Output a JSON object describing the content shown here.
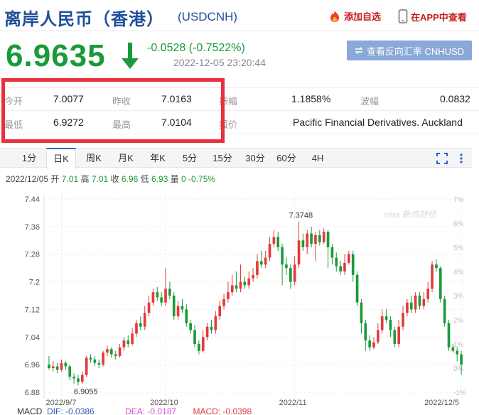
{
  "header": {
    "title": "离岸人民币（香港）",
    "code": "(USDCNH)",
    "add_fav_label": "添加自选",
    "app_view_label": "在APP中查看"
  },
  "quote": {
    "price": "6.9635",
    "change": "-0.0528 (-0.7522%)",
    "timestamp": "2022-12-05 23:20:44",
    "reverse_button_label": "查看反向汇率 CNHUSD"
  },
  "stats": {
    "open_label": "今开",
    "open_value": "7.0077",
    "prev_close_label": "昨收",
    "prev_close_value": "7.0163",
    "amplitude_label": "振幅",
    "amplitude_value": "1.1858%",
    "wave_label": "波幅",
    "wave_value": "0.0832",
    "low_label": "最低",
    "low_value": "6.9272",
    "high_label": "最高",
    "high_value": "7.0104",
    "quote_label": "报价",
    "quote_value": "Pacific Financial Derivatives. Auckland"
  },
  "tabs": [
    "1分",
    "日K",
    "周K",
    "月K",
    "年K",
    "5分",
    "15分",
    "30分",
    "60分",
    "4H"
  ],
  "active_tab": "日K",
  "ohlc": {
    "date": "2022/12/05",
    "open_label": "开",
    "open": "7.01",
    "high_label": "高",
    "high": "7.01",
    "close_label": "收",
    "close": "6.96",
    "low_label": "低",
    "low": "6.93",
    "vol_label": "量",
    "vol": "0",
    "pct": "-0.75%"
  },
  "chart_data": {
    "type": "candlestick",
    "y_ticks": [
      "7.44",
      "7.36",
      "7.28",
      "7.2",
      "7.12",
      "7.04",
      "6.96",
      "6.88"
    ],
    "pct_ticks": [
      "7%",
      "6%",
      "5%",
      "4%",
      "3%",
      "2%",
      "1%",
      "0%",
      "-1%"
    ],
    "x_ticks": [
      "2022/9/7",
      "2022/10",
      "2022/11",
      "2022/12/5"
    ],
    "ylim": [
      6.88,
      7.44
    ],
    "annotations": {
      "max": "7.3748",
      "min": "6.9055"
    },
    "up_color": "#e23b3b",
    "down_color": "#1a9a3b",
    "candles": [
      [
        6.96,
        6.95,
        6.985,
        6.945
      ],
      [
        6.95,
        6.955,
        6.97,
        6.94
      ],
      [
        6.955,
        6.945,
        6.965,
        6.935
      ],
      [
        6.945,
        6.965,
        6.975,
        6.94
      ],
      [
        6.965,
        6.955,
        6.97,
        6.945
      ],
      [
        6.955,
        6.925,
        6.96,
        6.915
      ],
      [
        6.925,
        6.92,
        6.935,
        6.905
      ],
      [
        6.92,
        6.91,
        6.93,
        6.9
      ],
      [
        6.91,
        6.93,
        6.94,
        6.905
      ],
      [
        6.93,
        6.98,
        6.985,
        6.925
      ],
      [
        6.98,
        6.975,
        6.99,
        6.965
      ],
      [
        6.975,
        6.965,
        6.985,
        6.955
      ],
      [
        6.965,
        6.96,
        6.975,
        6.95
      ],
      [
        6.96,
        6.995,
        7.0,
        6.955
      ],
      [
        6.995,
        7.005,
        7.015,
        6.985
      ],
      [
        7.005,
        6.99,
        7.01,
        6.98
      ],
      [
        6.99,
        6.985,
        7.0,
        6.975
      ],
      [
        6.985,
        7.01,
        7.02,
        6.98
      ],
      [
        7.01,
        7.03,
        7.04,
        7.0
      ],
      [
        7.03,
        7.02,
        7.045,
        7.01
      ],
      [
        7.02,
        7.05,
        7.065,
        7.015
      ],
      [
        7.05,
        7.08,
        7.09,
        7.04
      ],
      [
        7.08,
        7.07,
        7.1,
        7.06
      ],
      [
        7.07,
        7.11,
        7.13,
        7.06
      ],
      [
        7.11,
        7.14,
        7.16,
        7.1
      ],
      [
        7.14,
        7.17,
        7.18,
        7.13
      ],
      [
        7.17,
        7.155,
        7.185,
        7.145
      ],
      [
        7.155,
        7.14,
        7.17,
        7.13
      ],
      [
        7.14,
        7.18,
        7.24,
        7.13
      ],
      [
        7.18,
        7.16,
        7.2,
        7.15
      ],
      [
        7.16,
        7.1,
        7.17,
        7.09
      ],
      [
        7.1,
        7.13,
        7.145,
        7.09
      ],
      [
        7.13,
        7.12,
        7.15,
        7.11
      ],
      [
        7.12,
        7.08,
        7.135,
        7.07
      ],
      [
        7.08,
        7.06,
        7.09,
        7.05
      ],
      [
        7.06,
        7.02,
        7.075,
        7.01
      ],
      [
        7.02,
        7.0,
        7.03,
        6.99
      ],
      [
        7.0,
        7.04,
        7.06,
        6.995
      ],
      [
        7.04,
        7.07,
        7.08,
        7.03
      ],
      [
        7.07,
        7.06,
        7.09,
        7.05
      ],
      [
        7.06,
        7.1,
        7.115,
        7.05
      ],
      [
        7.1,
        7.13,
        7.145,
        7.09
      ],
      [
        7.13,
        7.15,
        7.165,
        7.12
      ],
      [
        7.15,
        7.17,
        7.2,
        7.14
      ],
      [
        7.17,
        7.19,
        7.22,
        7.16
      ],
      [
        7.19,
        7.18,
        7.23,
        7.17
      ],
      [
        7.18,
        7.2,
        7.25,
        7.17
      ],
      [
        7.2,
        7.19,
        7.215,
        7.18
      ],
      [
        7.19,
        7.21,
        7.23,
        7.18
      ],
      [
        7.21,
        7.22,
        7.24,
        7.2
      ],
      [
        7.22,
        7.26,
        7.28,
        7.21
      ],
      [
        7.26,
        7.25,
        7.29,
        7.24
      ],
      [
        7.25,
        7.27,
        7.29,
        7.24
      ],
      [
        7.27,
        7.31,
        7.33,
        7.26
      ],
      [
        7.31,
        7.33,
        7.35,
        7.3
      ],
      [
        7.33,
        7.3,
        7.345,
        7.29
      ],
      [
        7.3,
        7.25,
        7.31,
        7.19
      ],
      [
        7.25,
        7.24,
        7.27,
        7.22
      ],
      [
        7.24,
        7.2,
        7.25,
        7.18
      ],
      [
        7.2,
        7.25,
        7.275,
        7.19
      ],
      [
        7.25,
        7.32,
        7.375,
        7.24
      ],
      [
        7.32,
        7.3,
        7.34,
        7.29
      ],
      [
        7.3,
        7.34,
        7.35,
        7.28
      ],
      [
        7.34,
        7.31,
        7.36,
        7.3
      ],
      [
        7.31,
        7.335,
        7.345,
        7.26
      ],
      [
        7.335,
        7.315,
        7.35,
        7.305
      ],
      [
        7.315,
        7.345,
        7.355,
        7.31
      ],
      [
        7.345,
        7.3,
        7.35,
        7.24
      ],
      [
        7.3,
        7.27,
        7.31,
        7.25
      ],
      [
        7.27,
        7.245,
        7.285,
        7.23
      ],
      [
        7.245,
        7.23,
        7.26,
        7.22
      ],
      [
        7.23,
        7.255,
        7.28,
        7.22
      ],
      [
        7.255,
        7.28,
        7.29,
        7.25
      ],
      [
        7.28,
        7.22,
        7.29,
        7.2
      ],
      [
        7.22,
        7.14,
        7.23,
        7.13
      ],
      [
        7.14,
        7.08,
        7.15,
        7.05
      ],
      [
        7.08,
        7.03,
        7.09,
        7.0
      ],
      [
        7.03,
        7.01,
        7.045,
        7.0
      ],
      [
        7.01,
        7.025,
        7.04,
        7.005
      ],
      [
        7.025,
        7.06,
        7.08,
        7.02
      ],
      [
        7.06,
        7.1,
        7.12,
        7.05
      ],
      [
        7.1,
        7.09,
        7.12,
        7.08
      ],
      [
        7.09,
        7.06,
        7.1,
        7.04
      ],
      [
        7.06,
        7.02,
        7.07,
        7.01
      ],
      [
        7.02,
        7.07,
        7.09,
        7.01
      ],
      [
        7.07,
        7.11,
        7.13,
        7.06
      ],
      [
        7.11,
        7.14,
        7.15,
        7.1
      ],
      [
        7.14,
        7.12,
        7.16,
        7.11
      ],
      [
        7.12,
        7.16,
        7.17,
        7.11
      ],
      [
        7.16,
        7.13,
        7.17,
        7.12
      ],
      [
        7.13,
        7.15,
        7.17,
        7.12
      ],
      [
        7.15,
        7.18,
        7.2,
        7.14
      ],
      [
        7.18,
        7.25,
        7.26,
        7.17
      ],
      [
        7.25,
        7.24,
        7.265,
        7.23
      ],
      [
        7.24,
        7.15,
        7.245,
        7.14
      ],
      [
        7.15,
        7.08,
        7.16,
        7.07
      ],
      [
        7.08,
        7.01,
        7.09,
        7.0
      ],
      [
        7.01,
        7.0,
        7.02,
        6.995
      ],
      [
        7.0,
        6.99,
        7.01,
        6.97
      ],
      [
        6.99,
        6.96,
        7.0,
        6.93
      ]
    ]
  },
  "macd": {
    "label": "MACD",
    "dif": "DIF: -0.0386",
    "dea": "DEA: -0.0187",
    "macd": "MACD: -0.0398",
    "dif_color": "#2e63b8",
    "dea_color": "#d94fd9",
    "macd_color": "#e23b3b"
  }
}
